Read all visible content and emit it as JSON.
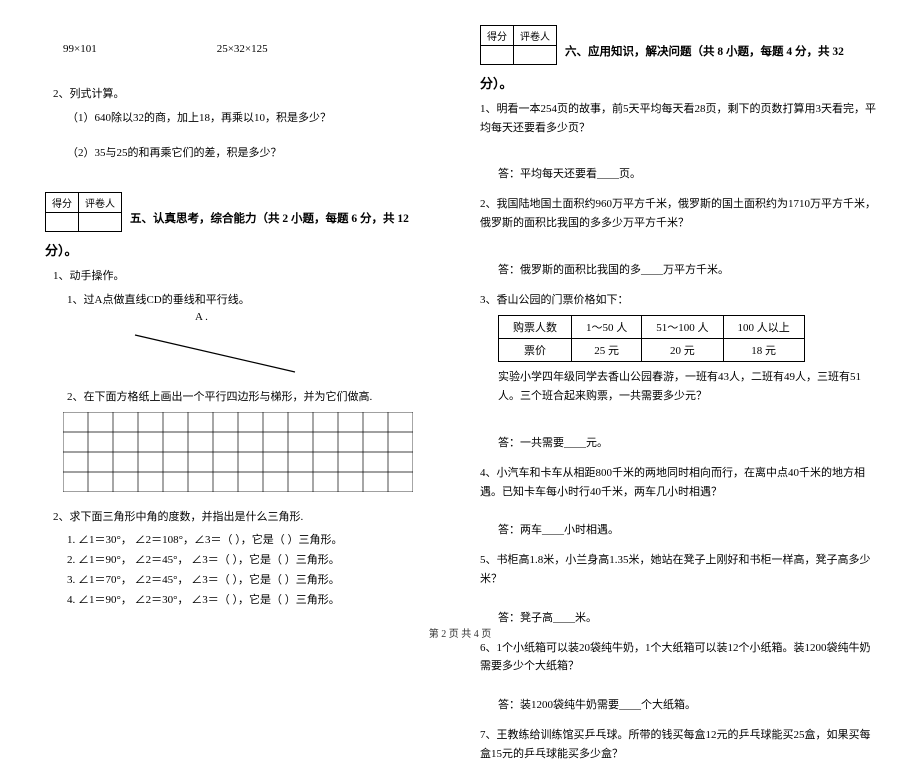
{
  "footer": "第 2 页 共 4 页",
  "scorebox": {
    "score": "得分",
    "grader": "评卷人"
  },
  "left": {
    "math": {
      "e1": "99×101",
      "e2": "25×32×125"
    },
    "q2": {
      "title": "2、列式计算。",
      "a": "（1）640除以32的商，加上18，再乘以10，积是多少？",
      "b": "（2）35与25的和再乘它们的差，积是多少？"
    },
    "section5_a": "五、认真思考，综合能力（共 2 小题，每题 6 分，共 12",
    "section5_b": "分）。",
    "s5q1": {
      "title": "1、动手操作。",
      "a": "1、过A点做直线CD的垂线和平行线。",
      "pointA": "A .",
      "b": "2、在下面方格纸上画出一个平行四边形与梯形，并为它们做高."
    },
    "s5q2": {
      "title": "2、求下面三角形中角的度数，并指出是什么三角形."
    },
    "angles": [
      "1.  ∠1＝30°，  ∠2＝108°，∠3＝（    ），它是（        ）三角形。",
      "2.  ∠1＝90°，  ∠2＝45°， ∠3＝（    ），它是（        ）三角形。",
      "3.  ∠1＝70°，  ∠2＝45°， ∠3＝（    ），它是（        ）三角形。",
      "4.  ∠1＝90°，  ∠2＝30°， ∠3＝（    ），它是（        ）三角形。"
    ]
  },
  "right": {
    "section6_a": "六、应用知识，解决问题（共 8 小题，每题 4 分，共 32",
    "section6_b": "分）。",
    "q1": "1、明看一本254页的故事，前5天平均每天看28页，剩下的页数打算用3天看完，平均每天还要看多少页？",
    "a1": "答：平均每天还要看____页。",
    "q2": "2、我国陆地国土面积约960万平方千米，俄罗斯的国土面积约为1710万平方千米，俄罗斯的面积比我国的多多少万平方千米？",
    "a2": "答：俄罗斯的面积比我国的多____万平方千米。",
    "q3": "3、香山公园的门票价格如下：",
    "ticket": {
      "h1": "购票人数",
      "h2": "1～50 人",
      "h3": "51～100 人",
      "h4": "100 人以上",
      "r1": "票价",
      "r2": "25 元",
      "r3": "20 元",
      "r4": "18 元"
    },
    "q3b": "实验小学四年级同学去香山公园春游，一班有43人，二班有49人，三班有51人。三个班合起来购票，一共需要多少元？",
    "a3": "答：一共需要____元。",
    "q4": "4、小汽车和卡车从相距800千米的两地同时相向而行，在离中点40千米的地方相遇。已知卡车每小时行40千米，两车几小时相遇？",
    "a4": "答：两车____小时相遇。",
    "q5": "5、书柜高1.8米，小兰身高1.35米，她站在凳子上刚好和书柜一样高，凳子高多少米？",
    "a5": "答：凳子高____米。",
    "q6": "6、1个小纸箱可以装20袋纯牛奶，1个大纸箱可以装12个小纸箱。装1200袋纯牛奶需要多少个大纸箱？",
    "a6": "答：装1200袋纯牛奶需要____个大纸箱。",
    "q7": "7、王教练给训练馆买乒乓球。所带的钱买每盒12元的乒乓球能买25盒，如果买每盒15元的乒乓球能买多少盒？"
  }
}
